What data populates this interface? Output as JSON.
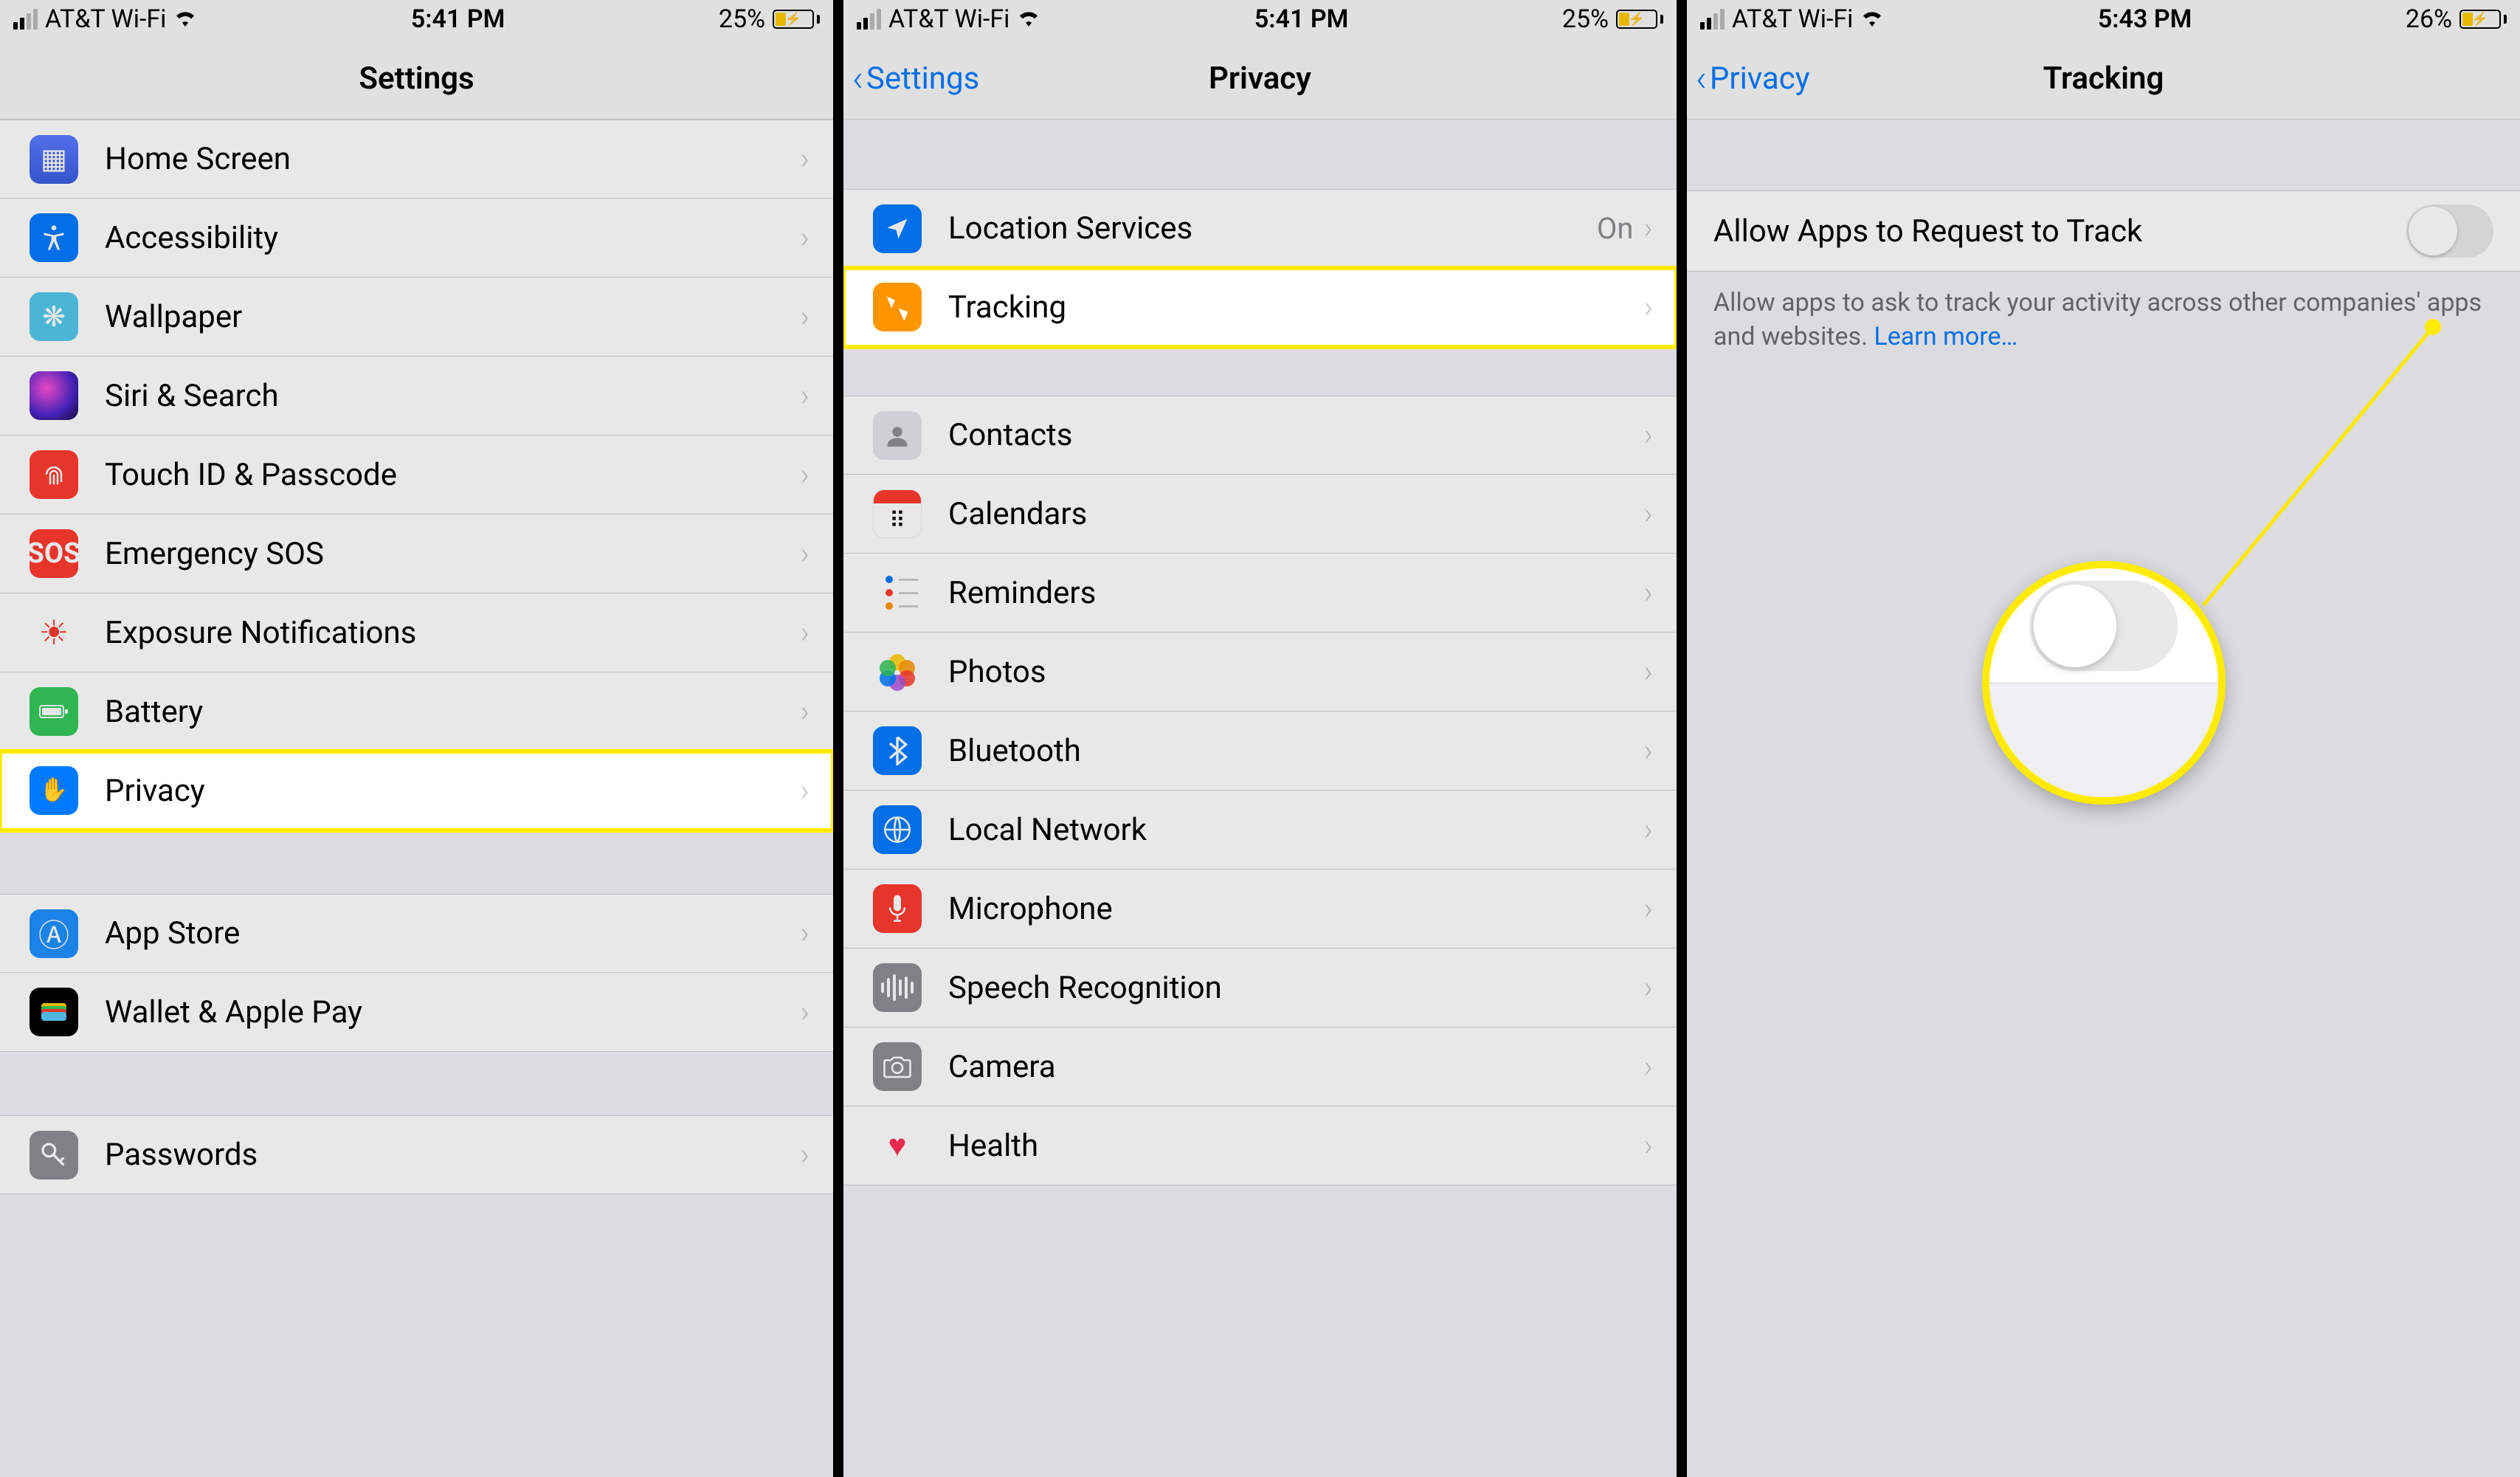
{
  "screen1": {
    "status": {
      "carrier": "AT&T Wi-Fi",
      "time": "5:41 PM",
      "battery": "25%"
    },
    "title": "Settings",
    "groups": [
      [
        {
          "icon": "home-screen-icon",
          "label": "Home Screen"
        },
        {
          "icon": "accessibility-icon",
          "label": "Accessibility"
        },
        {
          "icon": "wallpaper-icon",
          "label": "Wallpaper"
        },
        {
          "icon": "siri-search-icon",
          "label": "Siri & Search"
        },
        {
          "icon": "touch-id-icon",
          "label": "Touch ID & Passcode"
        },
        {
          "icon": "emergency-sos-icon",
          "label": "Emergency SOS"
        },
        {
          "icon": "exposure-notifications-icon",
          "label": "Exposure Notifications"
        },
        {
          "icon": "battery-icon",
          "label": "Battery"
        },
        {
          "icon": "privacy-icon",
          "label": "Privacy",
          "highlight": true
        }
      ],
      [
        {
          "icon": "app-store-icon",
          "label": "App Store"
        },
        {
          "icon": "wallet-apple-pay-icon",
          "label": "Wallet & Apple Pay"
        }
      ],
      [
        {
          "icon": "passwords-icon",
          "label": "Passwords"
        }
      ]
    ]
  },
  "screen2": {
    "status": {
      "carrier": "AT&T Wi-Fi",
      "time": "5:41 PM",
      "battery": "25%"
    },
    "back": "Settings",
    "title": "Privacy",
    "groups": [
      [
        {
          "icon": "location-services-icon",
          "label": "Location Services",
          "value": "On"
        },
        {
          "icon": "tracking-icon",
          "label": "Tracking",
          "highlight": true
        }
      ],
      [
        {
          "icon": "contacts-icon",
          "label": "Contacts"
        },
        {
          "icon": "calendars-icon",
          "label": "Calendars"
        },
        {
          "icon": "reminders-icon",
          "label": "Reminders"
        },
        {
          "icon": "photos-icon",
          "label": "Photos"
        },
        {
          "icon": "bluetooth-icon",
          "label": "Bluetooth"
        },
        {
          "icon": "local-network-icon",
          "label": "Local Network"
        },
        {
          "icon": "microphone-icon",
          "label": "Microphone"
        },
        {
          "icon": "speech-recognition-icon",
          "label": "Speech Recognition"
        },
        {
          "icon": "camera-icon",
          "label": "Camera"
        },
        {
          "icon": "health-icon",
          "label": "Health"
        }
      ]
    ]
  },
  "screen3": {
    "status": {
      "carrier": "AT&T Wi-Fi",
      "time": "5:43 PM",
      "battery": "26%"
    },
    "back": "Privacy",
    "title": "Tracking",
    "toggle_label": "Allow Apps to Request to Track",
    "toggle_on": false,
    "footer": "Allow apps to ask to track your activity across other companies' apps and websites. ",
    "learn_more": "Learn more…"
  }
}
